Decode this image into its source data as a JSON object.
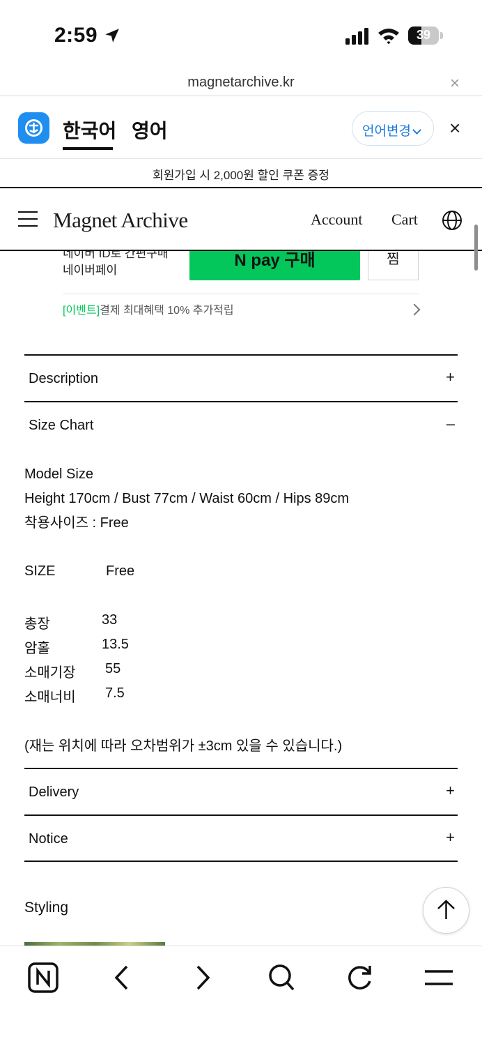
{
  "status_bar": {
    "time": "2:59",
    "battery": "39"
  },
  "browser": {
    "url": "magnetarchive.kr",
    "close_label": "×"
  },
  "translate_bar": {
    "tab_korean": "한국어",
    "tab_english": "영어",
    "change_language": "언어변경",
    "close_label": "×"
  },
  "promo": {
    "text": "회원가입 시 2,000원 할인 쿠폰 증정"
  },
  "header": {
    "brand": "Magnet Archive",
    "account": "Account",
    "cart": "Cart"
  },
  "npay": {
    "line1": "네이버 ID로 간편구매",
    "line2": "네이버페이",
    "button": "N pay 구매",
    "wish": "찜",
    "event_tag": "[이벤트]",
    "event_text": "결제 최대혜택 10% 추가적립"
  },
  "accordion": {
    "description": {
      "label": "Description",
      "sign": "+"
    },
    "size_chart": {
      "label": "Size Chart",
      "sign": "–"
    },
    "delivery": {
      "label": "Delivery",
      "sign": "+"
    },
    "notice": {
      "label": "Notice",
      "sign": "+"
    }
  },
  "size_chart": {
    "model_size_title": "Model Size",
    "model_measurements": "Height 170cm / Bust 77cm / Waist 60cm / Hips 89cm",
    "wear_size": "착용사이즈 : Free",
    "size_label": "SIZE",
    "size_value": "Free",
    "rows": [
      {
        "label": "총장",
        "value": "33"
      },
      {
        "label": "암홀",
        "value": "13.5"
      },
      {
        "label": "소매기장",
        "value": "55"
      },
      {
        "label": "소매너비",
        "value": "7.5"
      }
    ],
    "note": "(재는 위치에 따라 오차범위가 ±3cm 있을 수 있습니다.)"
  },
  "styling": {
    "title": "Styling"
  },
  "icons": {
    "location": "location-arrow-icon",
    "signal": "cellular-signal-icon",
    "wifi": "wifi-icon",
    "battery": "battery-icon",
    "translate_logo": "translate-logo-icon",
    "menu": "hamburger-menu-icon",
    "globe": "globe-icon",
    "back_to_top": "arrow-up-icon",
    "toolbar": [
      "naver-n-icon",
      "back-chevron-icon",
      "forward-chevron-icon",
      "search-icon",
      "refresh-icon",
      "menu-icon"
    ]
  },
  "colors": {
    "naver_green": "#03c75a",
    "translate_blue": "#1d7ce0"
  }
}
